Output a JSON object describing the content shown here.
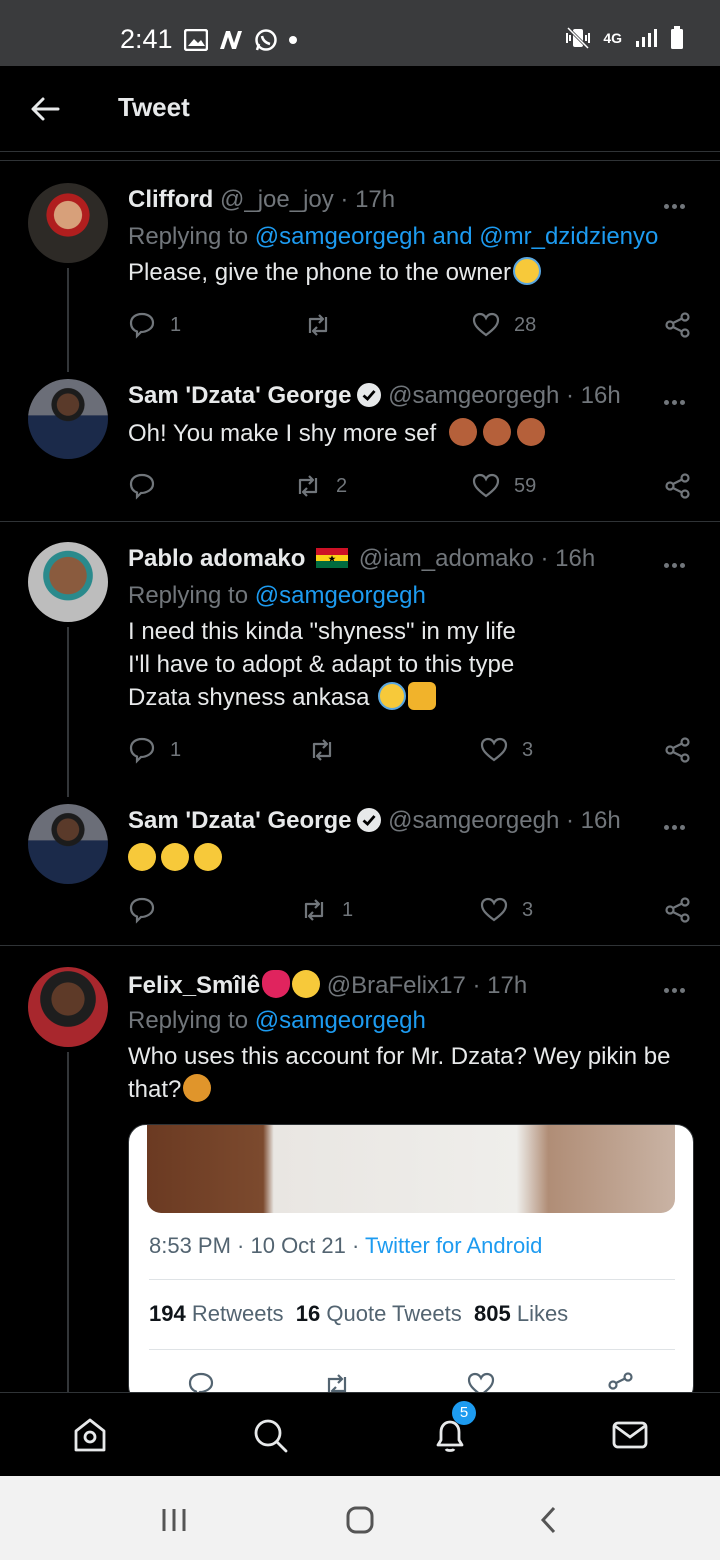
{
  "status_bar": {
    "time": "2:41",
    "network": "4G"
  },
  "header": {
    "title": "Tweet"
  },
  "tweets": [
    {
      "name": "Clifford",
      "handle": "@_joe_joy",
      "time": "· 17h",
      "replying_prefix": "Replying to",
      "replying_mentions": "@samgeorgegh and @mr_dzidzienyo",
      "text": "Please, give the phone to the owner",
      "replies": "1",
      "retweets": "",
      "likes": "28"
    },
    {
      "name": "Sam 'Dzata' George",
      "handle": "@samgeorgegh",
      "time": "· 16h",
      "text": "Oh! You make I shy more sef",
      "replies": "",
      "retweets": "2",
      "likes": "59"
    },
    {
      "name": "Pablo adomako",
      "handle": "@iam_adomako",
      "time": "· 16h",
      "replying_prefix": "Replying to",
      "replying_mentions": "@samgeorgegh",
      "text_lines": [
        "I need this kinda \"shyness\" in my life",
        "I'll have to adopt & adapt to this type",
        "Dzata shyness ankasa"
      ],
      "replies": "1",
      "retweets": "",
      "likes": "3"
    },
    {
      "name": "Sam 'Dzata' George",
      "handle": "@samgeorgegh",
      "time": "· 16h",
      "replies": "",
      "retweets": "1",
      "likes": "3"
    },
    {
      "name": "Felix_Smîlê",
      "handle": "@BraFelix17",
      "time": "· 17h",
      "replying_prefix": "Replying to",
      "replying_mentions": "@samgeorgegh",
      "text": "Who uses this account for Mr. Dzata? Wey pikin be that?"
    }
  ],
  "embedded_card": {
    "timestamp": "8:53 PM · 10 Oct 21 ·",
    "source": "Twitter for Android",
    "retweets_count": "194",
    "retweets_label": "Retweets",
    "quotes_count": "16",
    "quotes_label": "Quote Tweets",
    "likes_count": "805",
    "likes_label": "Likes"
  },
  "bottom_nav": {
    "notifications_badge": "5"
  },
  "colors": {
    "accent": "#1d9bf0",
    "background": "#000000",
    "muted": "#71767b"
  }
}
